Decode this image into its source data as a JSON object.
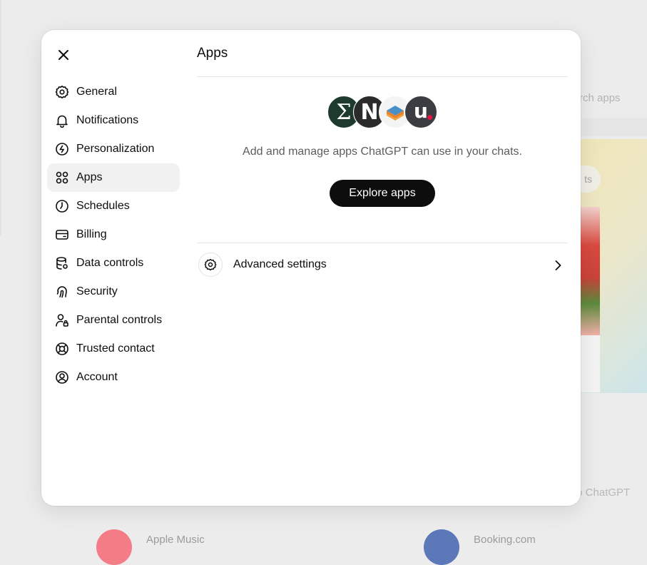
{
  "background": {
    "search_placeholder": "rch apps",
    "pill_label": "ts",
    "connect_text": "to ChatGPT",
    "apps": [
      {
        "name": "Apple Music",
        "color": "#f47c86"
      },
      {
        "name": "Booking.com",
        "color": "#5c78b8"
      }
    ]
  },
  "modal": {
    "close_icon": "close-icon",
    "nav": [
      {
        "label": "General",
        "icon": "gear-icon"
      },
      {
        "label": "Notifications",
        "icon": "bell-icon"
      },
      {
        "label": "Personalization",
        "icon": "personalization-icon"
      },
      {
        "label": "Apps",
        "icon": "apps-grid-icon",
        "active": true
      },
      {
        "label": "Schedules",
        "icon": "clock-icon"
      },
      {
        "label": "Billing",
        "icon": "credit-card-icon"
      },
      {
        "label": "Data controls",
        "icon": "database-icon"
      },
      {
        "label": "Security",
        "icon": "fingerprint-icon"
      },
      {
        "label": "Parental controls",
        "icon": "parental-icon"
      },
      {
        "label": "Trusted contact",
        "icon": "lifebuoy-icon"
      },
      {
        "label": "Account",
        "icon": "account-icon"
      }
    ],
    "apps_panel": {
      "title": "Apps",
      "logos": [
        {
          "glyph": "Σ",
          "color": "#1e3a2c"
        },
        {
          "glyph": "N",
          "color": "#2b2b2b"
        },
        {
          "glyph": "",
          "color": "#f4f4f4"
        },
        {
          "glyph": "u",
          "color": "#3b3d42",
          "accent": "#e5124a"
        }
      ],
      "tagline": "Add and manage apps ChatGPT can use in your chats.",
      "explore_label": "Explore apps",
      "advanced_label": "Advanced settings"
    }
  },
  "colors": {
    "primary_button": "#0d0d0d",
    "active_nav_bg": "#f1f1f1",
    "muted_text": "#5d5d5d"
  }
}
